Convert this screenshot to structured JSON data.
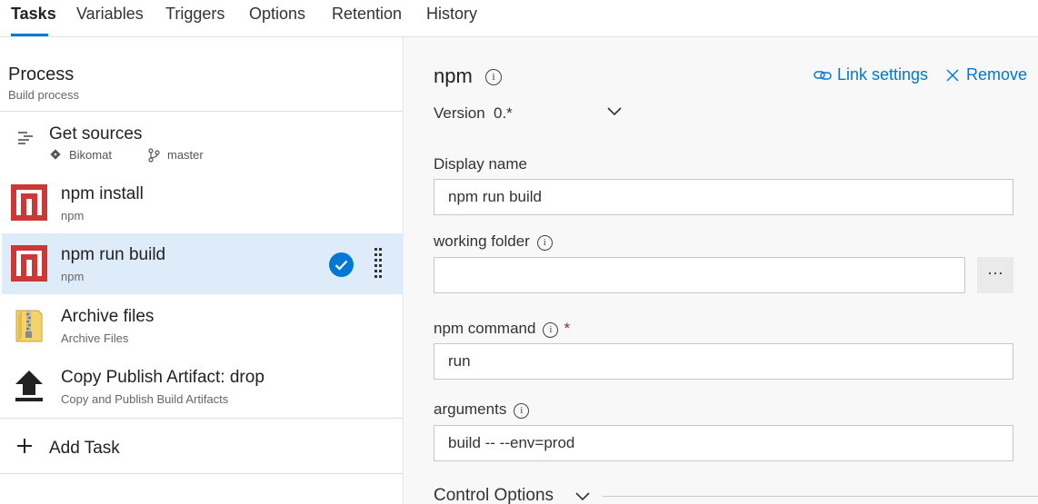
{
  "tabs": [
    {
      "label": "Tasks",
      "active": true
    },
    {
      "label": "Variables"
    },
    {
      "label": "Triggers"
    },
    {
      "label": "Options"
    },
    {
      "label": "Retention"
    },
    {
      "label": "History"
    }
  ],
  "process": {
    "title": "Process",
    "subtitle": "Build process"
  },
  "get_sources": {
    "title": "Get sources",
    "repo": "Bikomat",
    "branch": "master"
  },
  "tasks": [
    {
      "title": "npm install",
      "subtitle": "npm",
      "icon": "npm-icon"
    },
    {
      "title": "npm run build",
      "subtitle": "npm",
      "icon": "npm-icon",
      "selected": true
    },
    {
      "title": "Archive files",
      "subtitle": "Archive Files",
      "icon": "archive-icon"
    },
    {
      "title": "Copy Publish Artifact: drop",
      "subtitle": "Copy and Publish Build Artifacts",
      "icon": "upload-icon"
    }
  ],
  "add_task": "Add Task",
  "detail": {
    "title": "npm",
    "link_settings": "Link settings",
    "remove": "Remove",
    "version_label": "Version",
    "version_value": "0.*",
    "display_name_label": "Display name",
    "display_name_value": "npm run build",
    "working_folder_label": "working folder",
    "working_folder_value": "",
    "browse_label": "···",
    "npm_command_label": "npm command",
    "required_mark": "*",
    "npm_command_value": "run",
    "arguments_label": "arguments",
    "arguments_value": "build -- --env=prod",
    "control_options": "Control Options"
  },
  "colors": {
    "accent": "#0078d4",
    "npm_red": "#cb3837",
    "selected_bg": "#deecf9"
  }
}
